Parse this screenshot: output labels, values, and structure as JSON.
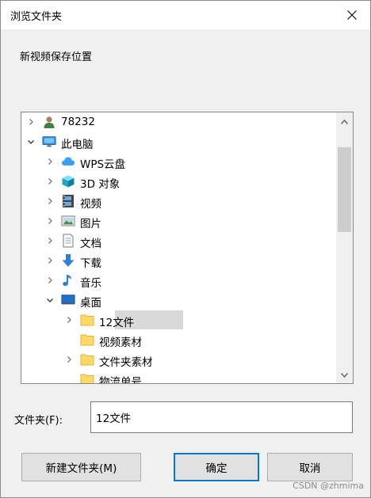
{
  "window": {
    "title": "浏览文件夹",
    "subtitle": "新视频保存位置"
  },
  "tree": {
    "items": [
      {
        "label": "78232",
        "icon": "user-icon",
        "expander": "chevron-right"
      },
      {
        "label": "此电脑",
        "icon": "computer-icon",
        "expander": "chevron-down"
      },
      {
        "label": "WPS云盘",
        "icon": "cloud-icon",
        "expander": "chevron-right"
      },
      {
        "label": "3D 对象",
        "icon": "cube-3d-icon",
        "expander": "chevron-right"
      },
      {
        "label": "视频",
        "icon": "film-icon",
        "expander": "chevron-right"
      },
      {
        "label": "图片",
        "icon": "picture-icon",
        "expander": "chevron-right"
      },
      {
        "label": "文档",
        "icon": "document-icon",
        "expander": "chevron-right"
      },
      {
        "label": "下载",
        "icon": "download-icon",
        "expander": "chevron-right"
      },
      {
        "label": "音乐",
        "icon": "music-icon",
        "expander": "chevron-right"
      },
      {
        "label": "桌面",
        "icon": "desktop-icon",
        "expander": "chevron-down"
      },
      {
        "label": "12文件",
        "icon": "folder-icon",
        "expander": "chevron-right",
        "selected": true
      },
      {
        "label": "视频素材",
        "icon": "folder-icon",
        "expander": "none"
      },
      {
        "label": "文件夹素材",
        "icon": "folder-icon",
        "expander": "chevron-right"
      },
      {
        "label": "物流单号",
        "icon": "folder-icon",
        "expander": "none"
      }
    ]
  },
  "folder": {
    "label": "文件夹(F):",
    "value": "12文件"
  },
  "buttons": {
    "new_folder": "新建文件夹(M)",
    "ok": "确定",
    "cancel": "取消"
  },
  "watermark": "CSDN @zhmima",
  "colors": {
    "accent": "#0078d7",
    "selection": "#d9d9d9",
    "folder": "#ffd966"
  }
}
